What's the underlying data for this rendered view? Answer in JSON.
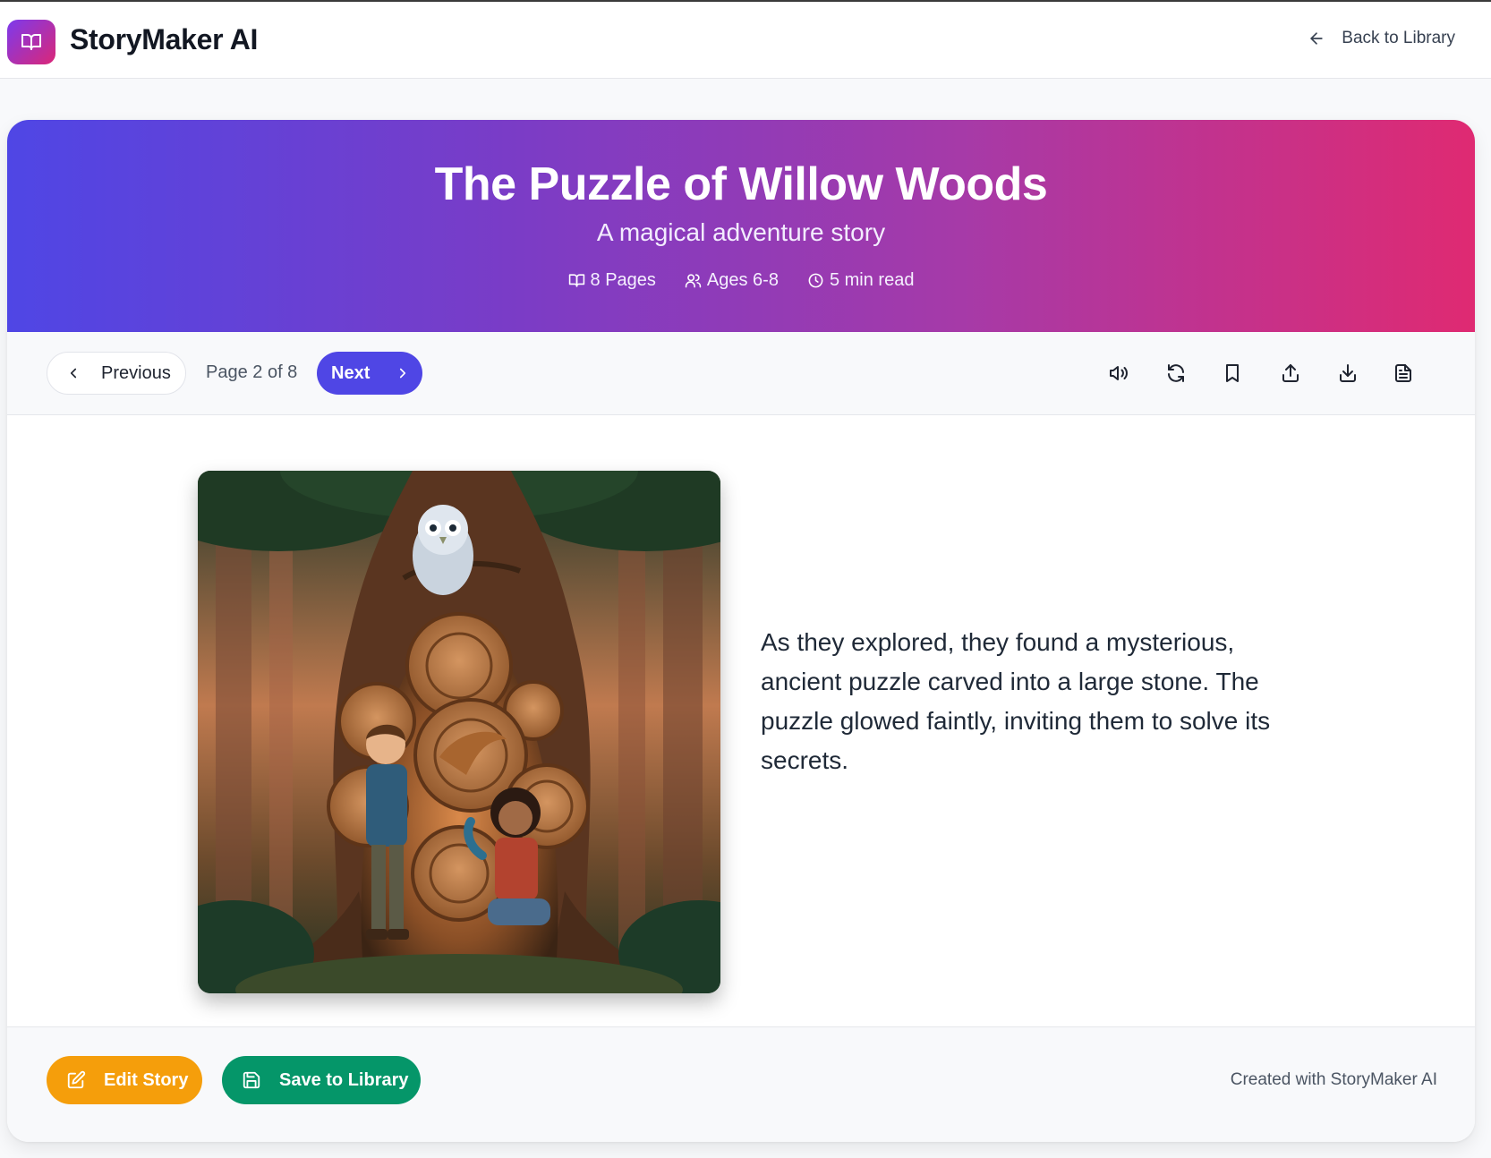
{
  "app": {
    "name": "StoryMaker AI",
    "logo_icon": "book-open-icon"
  },
  "header": {
    "back_label": "Back to Library",
    "back_icon": "arrow-left-icon"
  },
  "story": {
    "title": "The Puzzle of Willow Woods",
    "subtitle": "A magical adventure story",
    "meta": {
      "pages": "8 Pages",
      "ages": "Ages 6-8",
      "read_time": "5 min read"
    }
  },
  "navigation": {
    "previous_label": "Previous",
    "page_indicator": "Page 2 of 8",
    "next_label": "Next",
    "current_page": 2,
    "total_pages": 8
  },
  "toolbar_icons": [
    "volume-icon",
    "refresh-icon",
    "bookmark-icon",
    "share-icon",
    "download-icon",
    "document-icon"
  ],
  "page": {
    "text": "As they explored, they found a mysterious, ancient puzzle carved into a large stone. The puzzle glowed faintly, inviting them to solve its secrets."
  },
  "footer": {
    "edit_label": "Edit Story",
    "save_label": "Save to Library",
    "credit": "Created with StoryMaker AI"
  },
  "colors": {
    "primary": "#4f46e5",
    "hero_gradient_start": "#4f46e5",
    "hero_gradient_end": "#df2a72",
    "edit_button": "#f59e0b",
    "save_button": "#059669"
  }
}
